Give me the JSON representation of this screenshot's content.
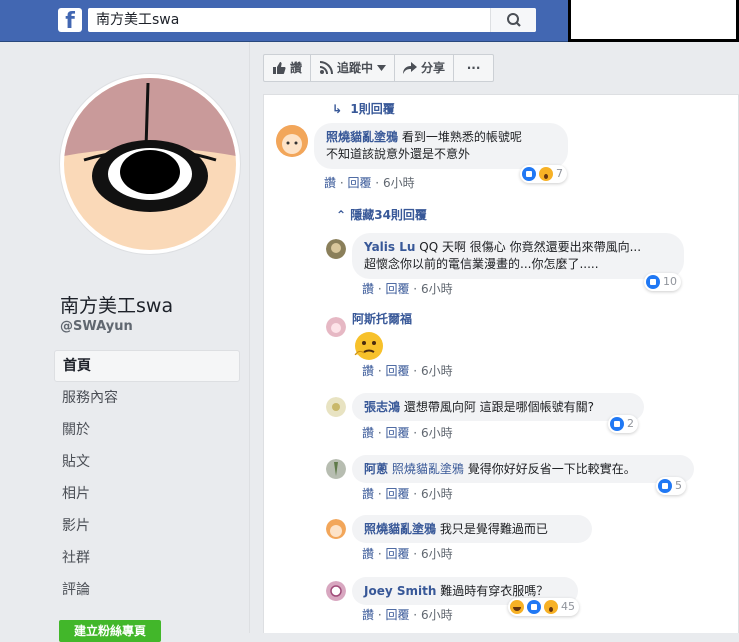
{
  "topbar": {
    "logo": "f",
    "search_value": "南方美工swa",
    "search_icon": "search-icon"
  },
  "sidebar": {
    "page_name": "南方美工swa",
    "page_handle": "@SWAyun",
    "nav_items": [
      {
        "label": "首頁",
        "active": true
      },
      {
        "label": "服務內容"
      },
      {
        "label": "關於"
      },
      {
        "label": "貼文"
      },
      {
        "label": "相片"
      },
      {
        "label": "影片"
      },
      {
        "label": "社群"
      },
      {
        "label": "評論"
      }
    ],
    "create_button": "建立粉絲專頁"
  },
  "actions": {
    "like": "讚",
    "following": "追蹤中",
    "share": "分享",
    "more": "···"
  },
  "thread": {
    "replies_link_1": "1則回覆",
    "top_comment": {
      "name": "照燒貓亂塗鴉",
      "text_line1": "看到一堆熟悉的帳號呢",
      "text_line2": "不知道該說意外還是不意外",
      "like": "讚",
      "reply": "回覆",
      "time": "6小時",
      "reactions": "7"
    },
    "hide_replies": "隱藏34則回覆",
    "replies": [
      {
        "name": "Yalis Lu",
        "text_line1": "QQ 天啊 很傷心 你竟然還要出來帶風向...",
        "text_line2": "超懷念你以前的電信業漫畫的...你怎麼了.....",
        "like": "讚",
        "reply": "回覆",
        "time": "6小時",
        "reactions": "10"
      },
      {
        "name": "阿斯托爾福",
        "like": "讚",
        "reply": "回覆",
        "time": "6小時"
      },
      {
        "name": "張志鴻",
        "text": "還想帶風向阿 這跟是哪個帳號有關?",
        "like": "讚",
        "reply": "回覆",
        "time": "6小時",
        "reactions": "2"
      },
      {
        "name": "阿蔥",
        "mention": "照燒貓亂塗鴉",
        "text": "覺得你好好反省一下比較實在。",
        "like": "讚",
        "reply": "回覆",
        "time": "6小時",
        "reactions": "5"
      },
      {
        "name": "照燒貓亂塗鴉",
        "text": "我只是覺得難過而已",
        "like": "讚",
        "reply": "回覆",
        "time": "6小時"
      },
      {
        "name": "Joey Smith",
        "text": "難過時有穿衣服嗎？",
        "like": "讚",
        "reply": "回覆",
        "time": "6小時",
        "reactions": "45"
      }
    ]
  },
  "colors": {
    "brand": "#4267b2",
    "link": "#385898",
    "green": "#42b72a"
  }
}
